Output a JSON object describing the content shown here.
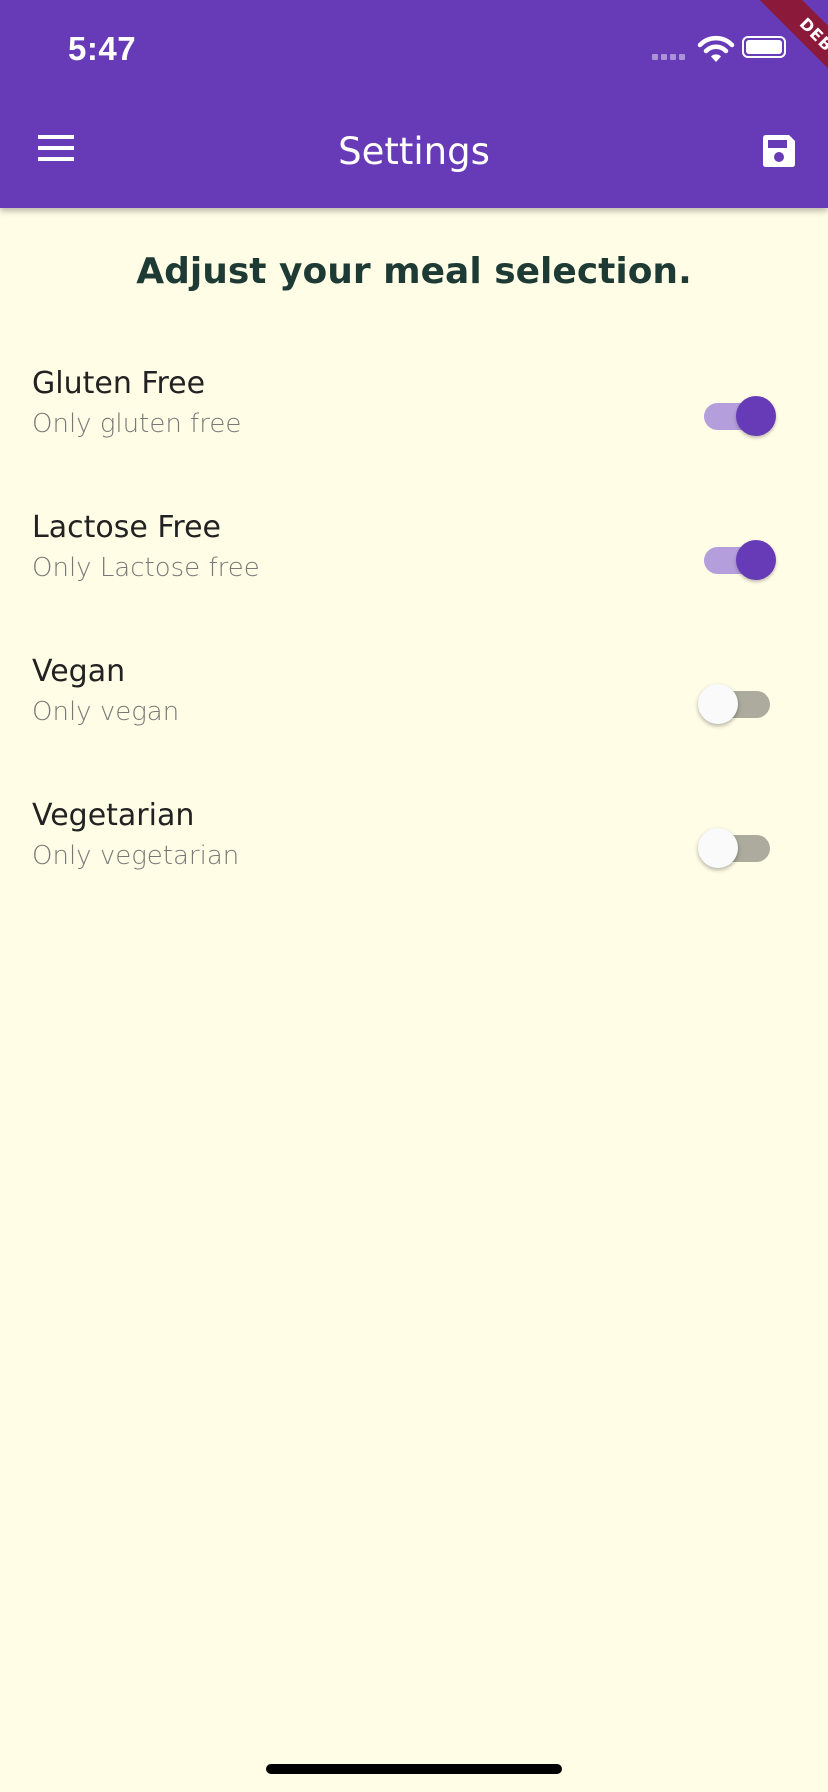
{
  "status_bar": {
    "time": "5:47"
  },
  "app_bar": {
    "title": "Settings",
    "menu_icon": "hamburger-menu-icon",
    "save_icon": "floppy-save-icon",
    "debug_banner": "DEBUG",
    "background_color": "#673ab7"
  },
  "page": {
    "heading": "Adjust your meal selection.",
    "background_color": "#fffde6"
  },
  "settings": [
    {
      "title": "Gluten Free",
      "subtitle": "Only gluten free",
      "enabled": true
    },
    {
      "title": "Lactose Free",
      "subtitle": "Only Lactose free",
      "enabled": true
    },
    {
      "title": "Vegan",
      "subtitle": "Only vegan",
      "enabled": false
    },
    {
      "title": "Vegetarian",
      "subtitle": "Only vegetarian",
      "enabled": false
    }
  ],
  "colors": {
    "accent": "#673ab7",
    "switch_track_on": "#b49edb",
    "switch_track_off": "#adab9d",
    "switch_thumb_off": "#fafafa"
  }
}
